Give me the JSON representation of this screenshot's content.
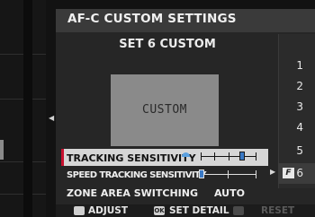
{
  "header": {
    "title": "AF-C CUSTOM SETTINGS"
  },
  "subtitle": "SET 6 CUSTOM",
  "preview": {
    "label": "CUSTOM"
  },
  "sets": [
    {
      "label": "1",
      "selected": false
    },
    {
      "label": "2",
      "selected": false
    },
    {
      "label": "3",
      "selected": false
    },
    {
      "label": "4",
      "selected": false
    },
    {
      "label": "5",
      "selected": false
    },
    {
      "label": "6",
      "selected": true
    }
  ],
  "settings": [
    {
      "label": "TRACKING SENSITIVITY",
      "control": "slider",
      "value": 3,
      "min": 0,
      "max": 4,
      "selected": true
    },
    {
      "label": "SPEED TRACKING SENSITIVITY",
      "control": "slider",
      "value": 0,
      "min": 0,
      "max": 2,
      "selected": false
    },
    {
      "label": "ZONE AREA SWITCHING",
      "control": "text",
      "value": "AUTO",
      "selected": false
    }
  ],
  "footer": {
    "adjust_label": "ADJUST",
    "ok_icon_label": "OK",
    "set_detail_label": "SET DETAIL",
    "reset_label": "RESET"
  },
  "colors": {
    "accent": "#c8102e",
    "slider_knob": "#3a79c5",
    "selected_row": "#d6d6d6",
    "header_bg": "#3a3a3a"
  },
  "icons": {
    "adjust": "dial-icon",
    "set_detail": "ok-button-icon",
    "reset": "trash-icon",
    "custom_marker": "f-custom-icon"
  }
}
